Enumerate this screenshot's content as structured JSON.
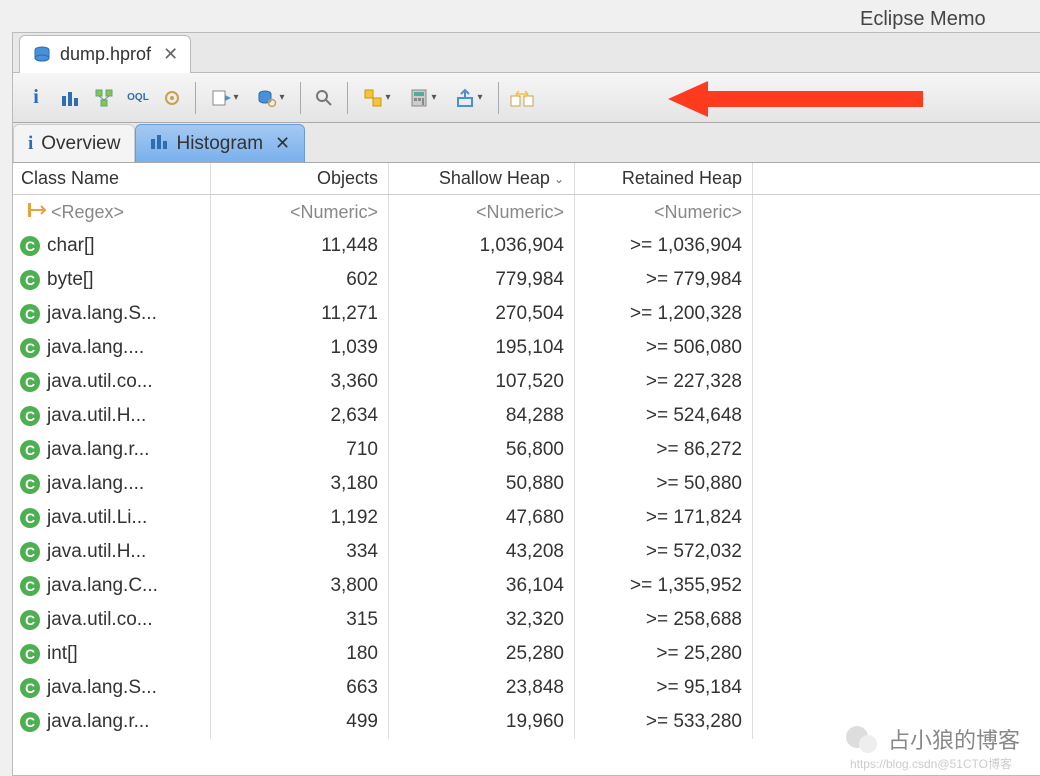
{
  "app_title": "Eclipse Memo",
  "file_tab": {
    "label": "dump.hprof"
  },
  "views": {
    "overview": "Overview",
    "histogram": "Histogram"
  },
  "columns": {
    "className": "Class Name",
    "objects": "Objects",
    "shallow": "Shallow Heap",
    "retained": "Retained Heap"
  },
  "filters": {
    "regex": "<Regex>",
    "numeric": "<Numeric>"
  },
  "rows": [
    {
      "name": "char[]",
      "objects": "11,448",
      "shallow": "1,036,904",
      "retained": ">= 1,036,904"
    },
    {
      "name": "byte[]",
      "objects": "602",
      "shallow": "779,984",
      "retained": ">= 779,984"
    },
    {
      "name": "java.lang.S...",
      "objects": "11,271",
      "shallow": "270,504",
      "retained": ">= 1,200,328"
    },
    {
      "name": "java.lang....",
      "objects": "1,039",
      "shallow": "195,104",
      "retained": ">= 506,080"
    },
    {
      "name": "java.util.co...",
      "objects": "3,360",
      "shallow": "107,520",
      "retained": ">= 227,328"
    },
    {
      "name": "java.util.H...",
      "objects": "2,634",
      "shallow": "84,288",
      "retained": ">= 524,648"
    },
    {
      "name": "java.lang.r...",
      "objects": "710",
      "shallow": "56,800",
      "retained": ">= 86,272"
    },
    {
      "name": "java.lang....",
      "objects": "3,180",
      "shallow": "50,880",
      "retained": ">= 50,880"
    },
    {
      "name": "java.util.Li...",
      "objects": "1,192",
      "shallow": "47,680",
      "retained": ">= 171,824"
    },
    {
      "name": "java.util.H...",
      "objects": "334",
      "shallow": "43,208",
      "retained": ">= 572,032"
    },
    {
      "name": "java.lang.C...",
      "objects": "3,800",
      "shallow": "36,104",
      "retained": ">= 1,355,952"
    },
    {
      "name": "java.util.co...",
      "objects": "315",
      "shallow": "32,320",
      "retained": ">= 258,688"
    },
    {
      "name": "int[]",
      "objects": "180",
      "shallow": "25,280",
      "retained": ">= 25,280"
    },
    {
      "name": "java.lang.S...",
      "objects": "663",
      "shallow": "23,848",
      "retained": ">= 95,184"
    },
    {
      "name": "java.lang.r...",
      "objects": "499",
      "shallow": "19,960",
      "retained": ">= 533,280"
    }
  ],
  "watermark": {
    "main": "占小狼的博客",
    "sub": "https://blog.csdn@51CTO博客"
  }
}
